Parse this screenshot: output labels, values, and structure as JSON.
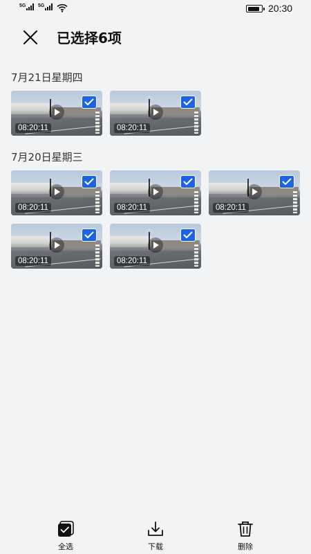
{
  "status_bar": {
    "sim1_label": "5G",
    "sim2_label": "5G",
    "time": "20:30",
    "battery_level": 0.9
  },
  "header": {
    "title": "已选择6项",
    "close_icon": "close-icon"
  },
  "groups": [
    {
      "date": "7月21日星期四",
      "items": [
        {
          "duration": "08:20:11",
          "selected": true
        },
        {
          "duration": "08:20:11",
          "selected": true
        }
      ]
    },
    {
      "date": "7月20日星期三",
      "items": [
        {
          "duration": "08:20:11",
          "selected": true
        },
        {
          "duration": "08:20:11",
          "selected": true
        },
        {
          "duration": "08:20:11",
          "selected": true
        },
        {
          "duration": "08:20:11",
          "selected": true
        },
        {
          "duration": "08:20:11",
          "selected": true
        }
      ]
    }
  ],
  "bottom_bar": {
    "select_all": "全选",
    "download": "下载",
    "delete": "删除"
  },
  "colors": {
    "accent": "#1d63e6",
    "background": "#f1f3f5"
  }
}
